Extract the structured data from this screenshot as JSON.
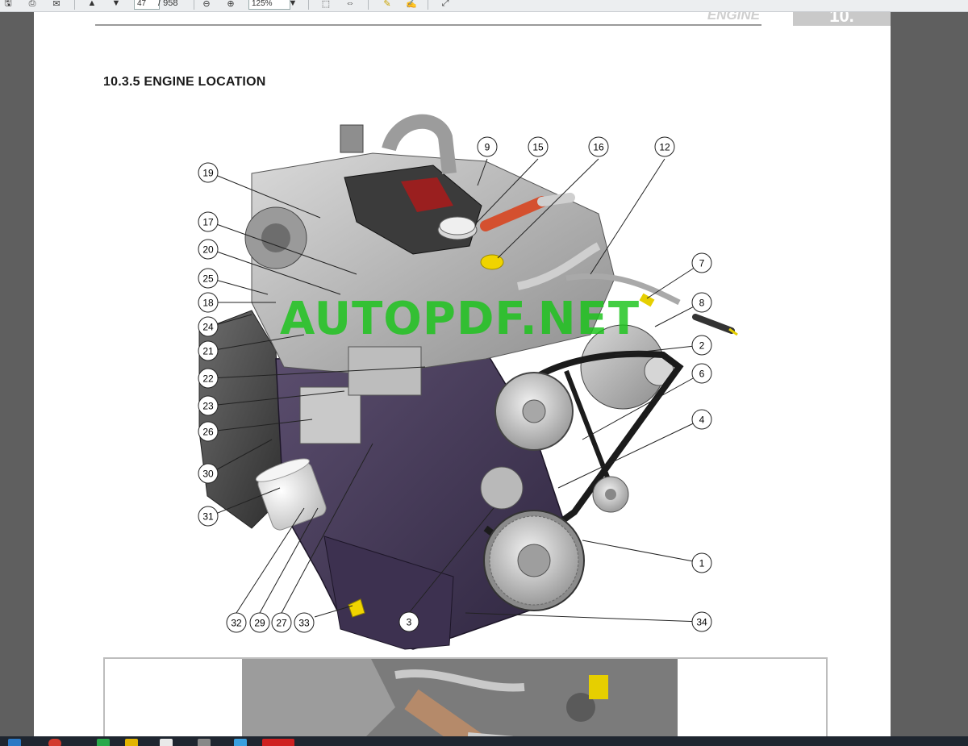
{
  "toolbar": {
    "page_current": "47",
    "page_total": "/ 958",
    "zoom": "125%",
    "zoom_arrow": "▼",
    "buttons": [
      "save",
      "print",
      "email",
      "previous-page",
      "next-page",
      "zoom-out",
      "zoom-in",
      "fit-page",
      "fit-width",
      "comment",
      "sign",
      "expand"
    ]
  },
  "document": {
    "header_text": "ENGINE",
    "header_tab": "10.",
    "section_title": "10.3.5 ENGINE LOCATION",
    "watermark": "AUTOPDF.NET"
  },
  "callouts": {
    "left": [
      "19",
      "17",
      "20",
      "25",
      "18",
      "24",
      "21",
      "22",
      "23",
      "26",
      "30",
      "31"
    ],
    "top": [
      "9",
      "15",
      "16",
      "12"
    ],
    "right": [
      "7",
      "8",
      "2",
      "6",
      "4",
      "1",
      "34"
    ],
    "bottom": [
      "32",
      "29",
      "27",
      "33",
      "3"
    ]
  },
  "colors": {
    "toolbar_bg": "#eceef0",
    "page_bg": "#ffffff",
    "viewer_bg": "#5f5f5f",
    "watermark": "#19c419",
    "block_purple": "#4b3f5c",
    "taskbar": "#1f2630"
  }
}
